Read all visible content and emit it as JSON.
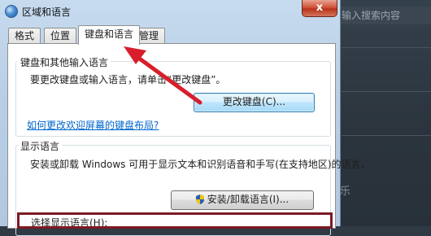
{
  "window": {
    "title": "区域和语言",
    "close_label": "x"
  },
  "tabs": [
    {
      "label": "格式",
      "active": false
    },
    {
      "label": "位置",
      "active": false
    },
    {
      "label": "键盘和语言",
      "active": true
    },
    {
      "label": "管理",
      "active": false
    }
  ],
  "keyboard_group": {
    "title": "键盘和其他输入语言",
    "description": "要更改键盘或输入语言，请单击“更改键盘”。",
    "change_button": "更改键盘(C)...",
    "help_link": "如何更改欢迎屏幕的键盘布局?"
  },
  "display_group": {
    "title": "显示语言",
    "description": "安装或卸载 Windows 可用于显示文本和识别语音和手写(在支持地区)的语言。",
    "install_button": "安装/卸载语言(I)...",
    "select_label": "选择显示语言(H):"
  },
  "background": {
    "search_placeholder": "输入搜索内容",
    "side_word": "乐"
  },
  "colors": {
    "annotation": "#d81e2a",
    "highlight_border": "#7d1a23",
    "link": "#0066cc"
  }
}
